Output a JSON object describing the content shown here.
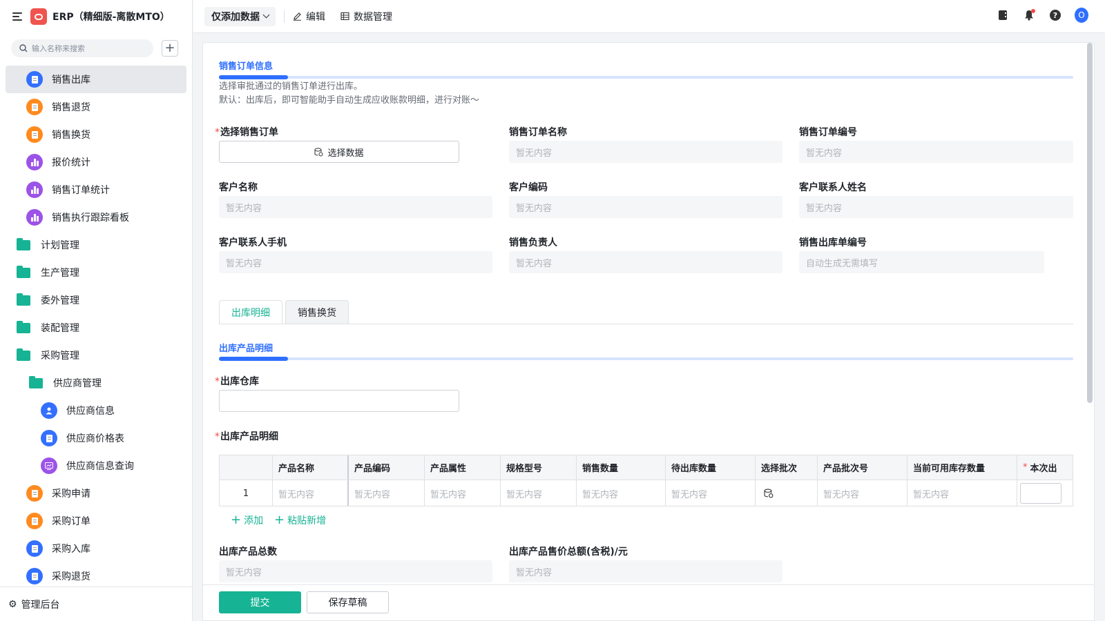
{
  "app": {
    "title": "ERP（精细版-离散MTO）"
  },
  "sidebar": {
    "search_placeholder": "输入名称来搜索",
    "items": [
      {
        "label": "销售出库",
        "icon": "document-icon"
      },
      {
        "label": "销售退货",
        "icon": "document-icon"
      },
      {
        "label": "销售换货",
        "icon": "document-icon"
      },
      {
        "label": "报价统计",
        "icon": "bar-chart-icon"
      },
      {
        "label": "销售订单统计",
        "icon": "bar-chart-icon"
      },
      {
        "label": "销售执行跟踪看板",
        "icon": "bar-chart-icon"
      },
      {
        "label": "计划管理",
        "icon": "folder-icon"
      },
      {
        "label": "生产管理",
        "icon": "folder-icon"
      },
      {
        "label": "委外管理",
        "icon": "folder-icon"
      },
      {
        "label": "装配管理",
        "icon": "folder-icon"
      },
      {
        "label": "采购管理",
        "icon": "folder-open-icon"
      },
      {
        "label": "供应商管理",
        "icon": "folder-open-icon"
      },
      {
        "label": "供应商信息",
        "icon": "user-icon"
      },
      {
        "label": "供应商价格表",
        "icon": "document-icon"
      },
      {
        "label": "供应商信息查询",
        "icon": "dashboard-icon"
      },
      {
        "label": "采购申请",
        "icon": "document-icon"
      },
      {
        "label": "采购订单",
        "icon": "document-icon"
      },
      {
        "label": "采购入库",
        "icon": "document-icon"
      },
      {
        "label": "采购退货",
        "icon": "document-icon"
      }
    ],
    "footer_label": "管理后台"
  },
  "toolbar": {
    "view_label": "仅添加数据",
    "edit_label": "编辑",
    "data_mgmt_label": "数据管理"
  },
  "colors": {
    "accent": "#16b394",
    "primary_blue": "#2f6fff"
  },
  "form": {
    "section1_title": "销售订单信息",
    "desc_line1": "选择审批通过的销售订单进行出库。",
    "desc_line2": "默认：出库后，即可智能助手自动生成应收账款明细，进行对账～",
    "required_mark": "*",
    "empty_text": "暂无内容",
    "fields": {
      "select_order_label": "选择销售订单",
      "select_data_btn": "选择数据",
      "order_name_label": "销售订单名称",
      "order_no_label": "销售订单编号",
      "customer_name_label": "客户名称",
      "customer_code_label": "客户编码",
      "contact_name_label": "客户联系人姓名",
      "contact_phone_label": "客户联系人手机",
      "sales_owner_label": "销售负责人",
      "outbound_no_label": "销售出库单编号",
      "outbound_no_placeholder": "自动生成无需填写"
    },
    "tabs": [
      "出库明细",
      "销售换货"
    ],
    "section2_title": "出库产品明细",
    "warehouse_label": "出库仓库",
    "details_label": "出库产品明细",
    "table": {
      "headers": [
        "产品名称",
        "产品编码",
        "产品属性",
        "规格型号",
        "销售数量",
        "待出库数量",
        "选择批次",
        "产品批次号",
        "当前可用库存数量",
        "本次出"
      ],
      "row_index": "1"
    },
    "add_label": "添加",
    "paste_label": "粘贴新增",
    "total_count_label": "出库产品总数",
    "total_amount_label": "出库产品售价总额(含税)/元"
  },
  "footer": {
    "submit_label": "提交",
    "draft_label": "保存草稿"
  }
}
